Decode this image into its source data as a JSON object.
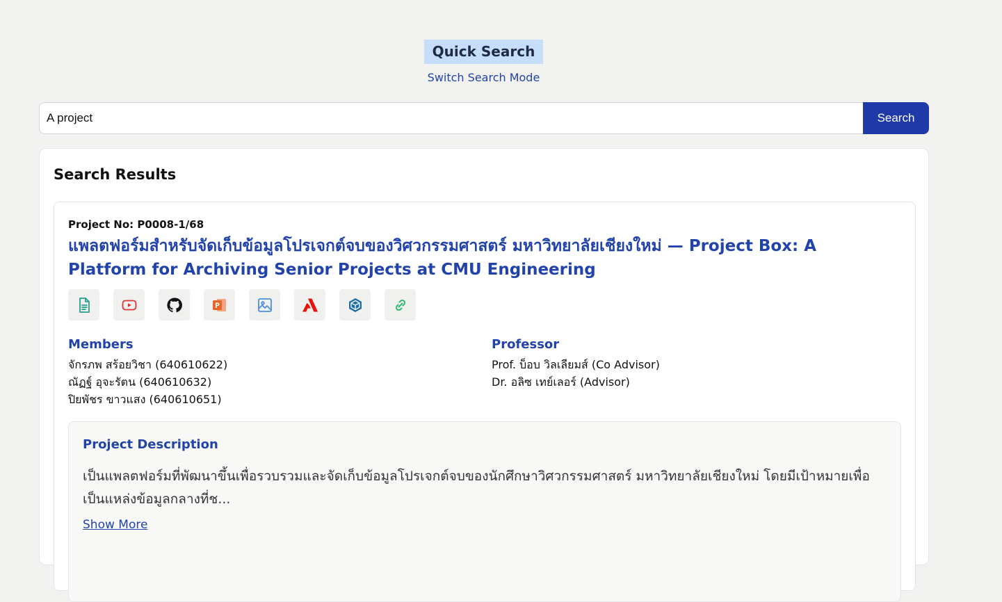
{
  "header": {
    "mode_title": "Quick Search",
    "switch_mode": "Switch Search Mode"
  },
  "search": {
    "value": "A project",
    "button": "Search"
  },
  "results": {
    "title": "Search Results",
    "project": {
      "number": "Project No: P0008-1/68",
      "title": "แพลตฟอร์มสำหรับจัดเก็บข้อมูลโปรเจกต์จบของวิศวกรรมศาสตร์ มหาวิทยาลัยเชียงใหม่ — Project Box: A Platform for Archiving Senior Projects at CMU Engineering",
      "links": [
        {
          "icon": "document-icon",
          "color": "#2a9d8f"
        },
        {
          "icon": "youtube-icon",
          "color": "#e03131"
        },
        {
          "icon": "github-icon",
          "color": "#111111"
        },
        {
          "icon": "powerpoint-icon",
          "color": "#e8652d"
        },
        {
          "icon": "image-icon",
          "color": "#4a90e2"
        },
        {
          "icon": "adobe-icon",
          "color": "#e8130e"
        },
        {
          "icon": "sketchup-icon",
          "color": "#1b6fa8"
        },
        {
          "icon": "link-icon",
          "color": "#2eb872"
        }
      ],
      "members_heading": "Members",
      "members": [
        "จักรภพ สร้อยวิชา (640610622)",
        "ณัฏฐ์ อุจะรัตน (640610632)",
        "ปิยพัชร ขาวแสง (640610651)"
      ],
      "professor_heading": "Professor",
      "professors": [
        "Prof. บ็อบ วิลเลียมส์ (Co Advisor)",
        "Dr. อลิซ เทย์เลอร์ (Advisor)"
      ],
      "description_heading": "Project Description",
      "description": "เป็นแพลตฟอร์มที่พัฒนาขึ้นเพื่อรวบรวมและจัดเก็บข้อมูลโปรเจกต์จบของนักศึกษาวิศวกรรมศาสตร์ มหาวิทยาลัยเชียงใหม่ โดยมีเป้าหมายเพื่อเป็นแหล่งข้อมูลกลางที่ช...",
      "show_more": "Show More"
    }
  }
}
